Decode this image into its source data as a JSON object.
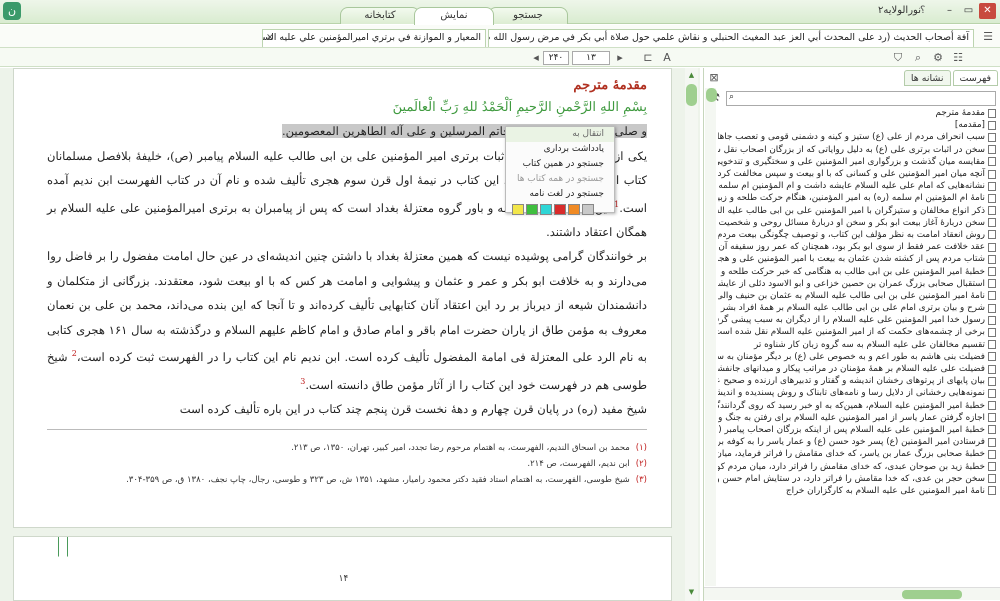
{
  "window": {
    "title": "نورالولایه۲",
    "help": "؟",
    "buttons": [
      "–",
      "▭",
      "✕"
    ]
  },
  "tabs": [
    "کتابخانه",
    "نمایش",
    "جستجو"
  ],
  "doc_tabs": {
    "first": "آفة أصحاب الحديث (رد على المحدث أبي العز عبد المغيث الحنبلي و نقاش علمي حول صلاة أبي بكر في مرض رسول الله صلى الله عليه و آله و سلم)",
    "second": "المعيار و الموازنة في برتري اميرالمؤمنين علي عليه السلام",
    "close": "×"
  },
  "nav": {
    "page": "۱۳",
    "total": "۲۴۰"
  },
  "content": {
    "heading": "مقدمهٔ مترجم",
    "bismillah": "بِسْمِ اللهِ الرَّحْمنِ الرَّحيمِ اَلْحَمْدُ للهِ رَبِّ الْعالَمينَ",
    "salawat": "و صلى الله على خلقه محمد خاتم المرسلين و على آله الطاهرين المعصومين.",
    "p1a": "یکی از آثار",
    "p1b": "و بی‌نظیر دربارهٔ اثبات برتری امیر المؤمنین علی بن ابی طالب علیه السلام",
    "p1c": "پیامبر (ص)، خلیفهٔ بلافصل مسلمانان کتاب المعیار و الموازنة است. این کتاب در نیمهٔ اول قرن سوم هجری تألیف شده و نام آن",
    "p1d": "در کتاب الفهرست ابن ندیم آمده است.",
    "p1e": "این کتاب نمودار اندیشه و باور گروه معتزلهٔ بغداد است که پس از پیامبران به برتری امیرالمؤمنین علی علیه السلام بر همگان اعتقاد داشتند.",
    "p2": "بر خوانندگان گرامی پوشیده نیست که همین معتزلهٔ بغداد با داشتن چنین اندیشه‌ای در عین حال امامت مفضول را بر فاضل روا می‌دارند و به خلافت ابو بکر و عمر و عثمان و پیشوایی و امامت هر کس که با او بیعت شود، معتقدند. بزرگانی از متکلمان و دانشمندان شیعه از دیرباز بر رد این اعتقاد آنان کتابهایی تألیف کرده‌اند و تا آنجا که این بنده می‌داند، محمد بن علی بن نعمان معروف به مؤمن طاق از یاران حضرت امام باقر و امام صادق و امام کاظم علیهم السلام و درگذشته به سال ۱۶۱ هجری کتابی به نام الرد علی المعتزلة فی امامة المفضول تألیف کرده است. ابن ندیم نام این کتاب را در الفهرست ثبت کرده است،",
    "p2b": "شیخ طوسی هم در فهرست خود این کتاب را از آثار مؤمن طاق دانسته است.",
    "p3": "شیخ مفید (ره) در پایان قرن چهارم و دههٔ نخست قرن پنجم چند کتاب در این باره تألیف کرده است",
    "sup1": "1",
    "sup2": "2",
    "sup3": "3",
    "footnotes": [
      {
        "num": "(۱)",
        "text": "محمد بن اسحاق الندیم، الفهرست، به اهتمام مرحوم رضا تجدد، امیر کبیر، تهران، ۱۳۵۰، ص ۲۱۳."
      },
      {
        "num": "(۲)",
        "text": "ابن ندیم، الفهرست، ص ۲۱۴."
      },
      {
        "num": "(۳)",
        "text": "شیخ طوسی، الفهرست، به اهتمام استاد فقید دکتر محمود رامیار، مشهد، ۱۳۵۱ ش، ص ۳۲۳ و طوسی، رجال، چاپ نجف، ۱۳۸۰ ق، ص ۳۵۹-۳۰۴."
      }
    ],
    "page_number": "۱۴"
  },
  "context_menu": {
    "items": [
      "انتقال به",
      "یادداشت برداری",
      "جستجو در همین کتاب",
      "جستجو در همه کتاب ها",
      "جستجو در لغت نامه"
    ],
    "colors": [
      "#f2e64a",
      "#3fbf3f",
      "#2fd6d6",
      "#d92c2c",
      "#f08a24",
      "#c9c9c9"
    ]
  },
  "right_tabs": [
    "فهرست",
    "نشانه ها"
  ],
  "toc": [
    "مقدمهٔ مترجم",
    "[مقدمه]",
    "سبب انحراف مردم از علی (ع) ستیز و کینه و دشمنی قومی و تعصب جاهلی است",
    "سخن در اثبات برتری علی (ع) به دلیل روایاتی که از بزرگان اصحاب نقل شده است",
    "مقایسه میان گذشت و بزرگواری امیر المؤمنین علی و سختگیری و تندخویی کسان",
    "آنچه میان امیر المؤمنین علی و کسانی که با او بیعت و سپس مخالفت کردند، گذشت",
    "نشانه‌هایی که امام علی علیه السلام عایشه داشت و ام المؤمنین ام سلمه که درود خداوند بر او",
    "نامهٔ ام المؤمنین ام سلمه (ره) به امیر المؤمنین، هنگام حرکت طلحه و زبیر و عایشه",
    "ذکر انواع مخالفان و ستیزگران با امیر المؤمنین علی بن ابی طالب علیه السلام",
    "سخن دربارهٔ آغاز بیعت ابو بکر و سخن او دربارهٔ مسائل روحی و شخصیت خویش",
    "روش انعقاد امامت به نظر مؤلف این کتاب، و توصیف چگونگی بیعت مردم با امیر المؤمنین",
    "عقد خلافت عمر فقط از سوی ابو بکر بود، همچنان که عمر روز سقیفه آن را برای او",
    "شتاب مردم پس از کشته شدن عثمان به بیعت با امیر المؤمنین علی و هجوم آنان",
    "خطبهٔ امیر المؤمنین علی بن ابی طالب به هنگامی که خبر حرکت طلحه و زبیر و عایشه",
    "استقبال صحابی بزرگ عمران بن حصین خزاعی و ابو الاسود دئلی از عایشه در بصره",
    "نامهٔ امیر المؤمنین علی بن ابی طالب علیه السلام به عثمان بن حنیف والی خود",
    "شرح و بیان برتری امام علی بن ابی طالب علیه السلام بر همهٔ افراد بشر پس از پیامبر",
    "رسول خدا امیر المؤمنین علی علیه السلام را از دیگران به سبب پیشی گرفتن او بر",
    "برخی از چشمه‌های حکمت که از امیر المؤمنین علیه السلام نقل شده است",
    "تقسیم مخالفان علی علیه السلام به سه گروه زبان کار شناوه تر",
    "فضیلت بنی هاشم به طور اعم و به خصوص علی (ع) بر دیگر مؤمنان به سبب تقوا",
    "فضیلت علی علیه السلام بر همهٔ مؤمنان در مراتب پیکار و میدانهای جانفشانی",
    "بیان پایهای از پرتوهای رخشان اندیشه و گفتار و تدبیرهای ارزنده و صحیح علوی",
    "نمونه‌هایی رخشانی از دلایل رسا و نامه‌های تابناک و روش پسندیده و اندیشهٔ درست",
    "خطبهٔ امیر المؤمنین علیه السلام، همین‌که به او خبر رسید که روی گردانندگان از",
    "اجازه گرفتن عمار یاسر از امیر المؤمنین علیه السلام برای رفتن به جنگ و همراه",
    "خطبهٔ امیر المؤمنین علی علیه السلام پس از اینکه بزرگان اصحاب پیامبر (ص) به او",
    "فرستادن امیر المؤمنین (ع) پسر خود حسن (ع) و عمار یاسر را به کوفه برای بسیج",
    "خطبهٔ صحابی بزرگ عمار بن یاسر، که خدای مقامش را فراتر فرماید، میان مردم",
    "خطبهٔ زید بن صوحان عبدی، که خدای مقامش را فراتر دارد، میان مردم کوفه و",
    "سخن حجر بن عدی، که خدا مقامش را فراتر دارد، در ستایش امام حسن و برانگیختن",
    "نامهٔ امیر المؤمنین علی علیه السلام به کارگزاران خراج"
  ]
}
